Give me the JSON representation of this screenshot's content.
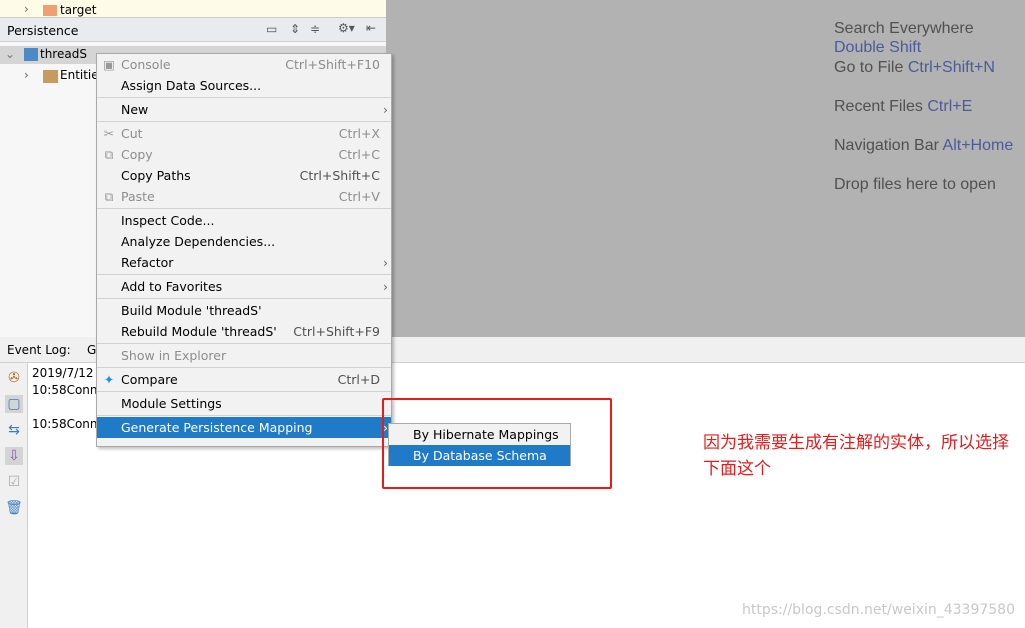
{
  "project_tree": {
    "target_label": "target"
  },
  "persistence_panel": {
    "title": "Persistence",
    "module": "threadS",
    "child": "Entitie"
  },
  "editor_hints": [
    {
      "text": "Search Everywhere ",
      "key": "Double Shift"
    },
    {
      "text": "Go to File ",
      "key": "Ctrl+Shift+N"
    },
    {
      "text": "Recent Files ",
      "key": "Ctrl+E"
    },
    {
      "text": "Navigation Bar ",
      "key": "Alt+Home"
    },
    {
      "text": "Drop files here to open",
      "key": ""
    }
  ],
  "event_log": {
    "title": "Event Log:",
    "tab": "G",
    "lines": [
      "2019/7/12",
      "10:58Conne",
      "10:58Conne"
    ]
  },
  "context_menu": {
    "items": [
      {
        "label": "Console",
        "shortcut": "Ctrl+Shift+F10",
        "disabled": true
      },
      {
        "label": "Assign Data Sources...",
        "shortcut": ""
      },
      {
        "label": "New",
        "shortcut": "",
        "submenu": true
      },
      {
        "label": "Cut",
        "shortcut": "Ctrl+X",
        "disabled": true
      },
      {
        "label": "Copy",
        "shortcut": "Ctrl+C",
        "disabled": true
      },
      {
        "label": "Copy Paths",
        "shortcut": "Ctrl+Shift+C"
      },
      {
        "label": "Paste",
        "shortcut": "Ctrl+V",
        "disabled": true
      },
      {
        "label": "Inspect Code...",
        "shortcut": ""
      },
      {
        "label": "Analyze Dependencies...",
        "shortcut": ""
      },
      {
        "label": "Refactor",
        "shortcut": "",
        "submenu": true
      },
      {
        "label": "Add to Favorites",
        "shortcut": "",
        "submenu": true
      },
      {
        "label": "Build Module 'threadS'",
        "shortcut": ""
      },
      {
        "label": "Rebuild Module 'threadS'",
        "shortcut": "Ctrl+Shift+F9"
      },
      {
        "label": "Show in Explorer",
        "shortcut": "",
        "disabled": true
      },
      {
        "label": "Compare",
        "shortcut": "Ctrl+D"
      },
      {
        "label": "Module Settings",
        "shortcut": ""
      },
      {
        "label": "Generate Persistence Mapping",
        "shortcut": "",
        "submenu": true,
        "selected": true
      }
    ]
  },
  "submenu": {
    "items": [
      {
        "label": "By Hibernate Mappings"
      },
      {
        "label": "By Database Schema",
        "selected": true
      }
    ]
  },
  "annotation": {
    "text": "因为我需要生成有注解的实体，所以选择下面这个",
    "color": "#e51c1c"
  },
  "watermark": "https://blog.csdn.net/weixin_43397580",
  "colors": {
    "selection": "#1f7bc8",
    "editor_bg": "#b2b2b2",
    "shortcut": "#4a5b9a"
  }
}
